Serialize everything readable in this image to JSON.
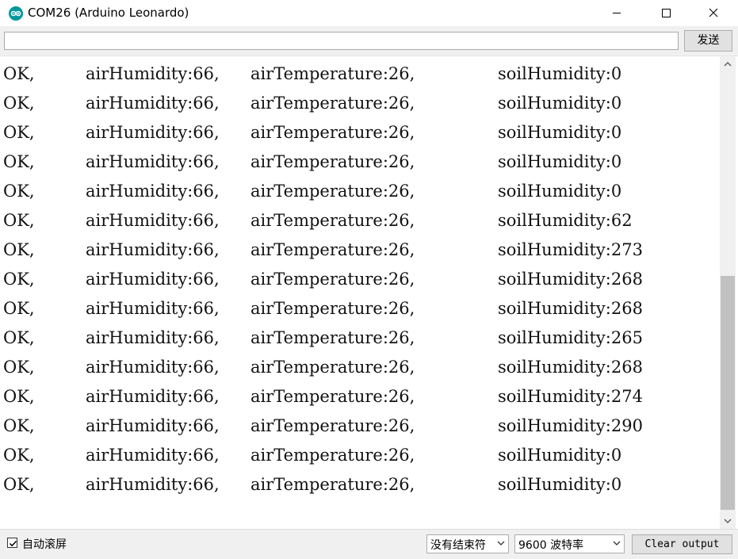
{
  "window": {
    "title": "COM26 (Arduino Leonardo)",
    "brand_color": "#00979C"
  },
  "toolbar": {
    "send_value": "",
    "send_label": "发送"
  },
  "output": {
    "lines": [
      [
        "OK,",
        "airHumidity:66,",
        "airTemperature:26,",
        "soilHumidity:0"
      ],
      [
        "OK,",
        "airHumidity:66,",
        "airTemperature:26,",
        "soilHumidity:0"
      ],
      [
        "OK,",
        "airHumidity:66,",
        "airTemperature:26,",
        "soilHumidity:0"
      ],
      [
        "OK,",
        "airHumidity:66,",
        "airTemperature:26,",
        "soilHumidity:0"
      ],
      [
        "OK,",
        "airHumidity:66,",
        "airTemperature:26,",
        "soilHumidity:0"
      ],
      [
        "OK,",
        "airHumidity:66,",
        "airTemperature:26,",
        "soilHumidity:62"
      ],
      [
        "OK,",
        "airHumidity:66,",
        "airTemperature:26,",
        "soilHumidity:273"
      ],
      [
        "OK,",
        "airHumidity:66,",
        "airTemperature:26,",
        "soilHumidity:268"
      ],
      [
        "OK,",
        "airHumidity:66,",
        "airTemperature:26,",
        "soilHumidity:268"
      ],
      [
        "OK,",
        "airHumidity:66,",
        "airTemperature:26,",
        "soilHumidity:265"
      ],
      [
        "OK,",
        "airHumidity:66,",
        "airTemperature:26,",
        "soilHumidity:268"
      ],
      [
        "OK,",
        "airHumidity:66,",
        "airTemperature:26,",
        "soilHumidity:274"
      ],
      [
        "OK,",
        "airHumidity:66,",
        "airTemperature:26,",
        "soilHumidity:290"
      ],
      [
        "OK,",
        "airHumidity:66,",
        "airTemperature:26,",
        "soilHumidity:0"
      ],
      [
        "OK,",
        "airHumidity:66,",
        "airTemperature:26,",
        "soilHumidity:0"
      ]
    ]
  },
  "statusbar": {
    "autoscroll_label": "自动滚屏",
    "autoscroll_checked": true,
    "line_ending": "没有结束符",
    "baud_rate": "9600 波特率",
    "clear_label": "Clear output"
  }
}
